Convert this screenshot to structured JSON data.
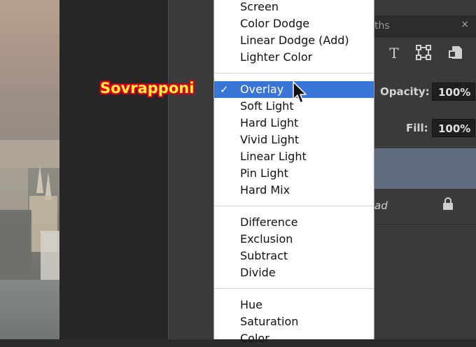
{
  "callout": {
    "label": "Sovrapponi",
    "color": "#ffef3a",
    "outline": "#d8001f"
  },
  "menu": {
    "groups": [
      [
        "Screen",
        "Color Dodge",
        "Linear Dodge (Add)",
        "Lighter Color"
      ],
      [
        "Overlay",
        "Soft Light",
        "Hard Light",
        "Vivid Light",
        "Linear Light",
        "Pin Light",
        "Hard Mix"
      ],
      [
        "Difference",
        "Exclusion",
        "Subtract",
        "Divide"
      ],
      [
        "Hue",
        "Saturation",
        "Color"
      ]
    ],
    "selected": "Overlay",
    "check_mark": "✓",
    "selected_color": "#3875d7"
  },
  "panel": {
    "tab_partial": "ths",
    "close_glyph": "×",
    "tools": [
      "type-icon",
      "transform-icon",
      "smart-object-icon"
    ],
    "opacity_label": "Opacity:",
    "opacity_value": "100%",
    "fill_label": "Fill:",
    "fill_value": "100%",
    "layer_partial": "ad"
  }
}
